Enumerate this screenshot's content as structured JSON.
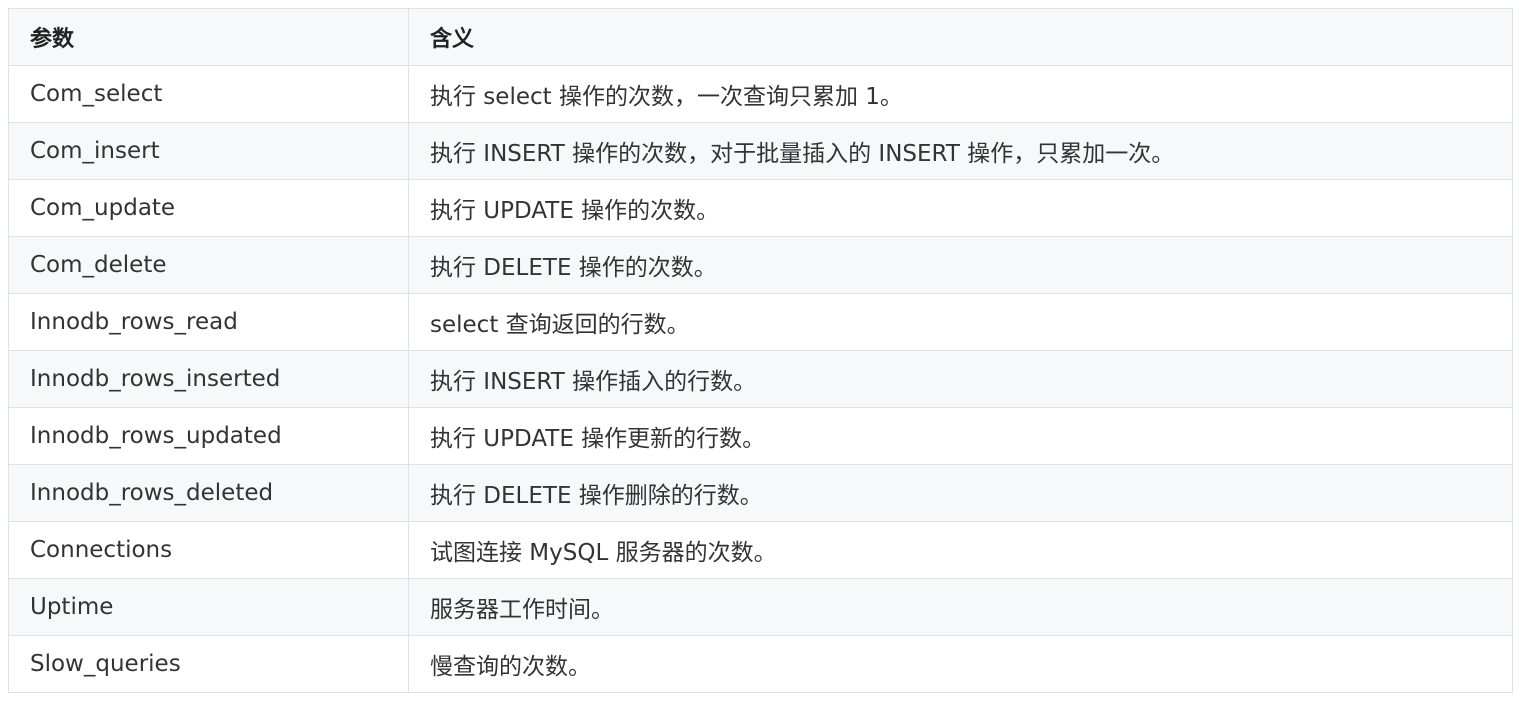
{
  "table": {
    "headers": [
      "参数",
      "含义"
    ],
    "rows": [
      [
        "Com_select",
        "执行 select 操作的次数，一次查询只累加 1。"
      ],
      [
        "Com_insert",
        "执行 INSERT 操作的次数，对于批量插入的 INSERT 操作，只累加一次。"
      ],
      [
        "Com_update",
        "执行 UPDATE 操作的次数。"
      ],
      [
        "Com_delete",
        "执行 DELETE 操作的次数。"
      ],
      [
        "Innodb_rows_read",
        "select 查询返回的行数。"
      ],
      [
        "Innodb_rows_inserted",
        "执行 INSERT 操作插入的行数。"
      ],
      [
        "Innodb_rows_updated",
        "执行 UPDATE 操作更新的行数。"
      ],
      [
        "Innodb_rows_deleted",
        "执行 DELETE 操作删除的行数。"
      ],
      [
        "Connections",
        "试图连接 MySQL 服务器的次数。"
      ],
      [
        "Uptime",
        "服务器工作时间。"
      ],
      [
        "Slow_queries",
        "慢查询的次数。"
      ]
    ]
  }
}
